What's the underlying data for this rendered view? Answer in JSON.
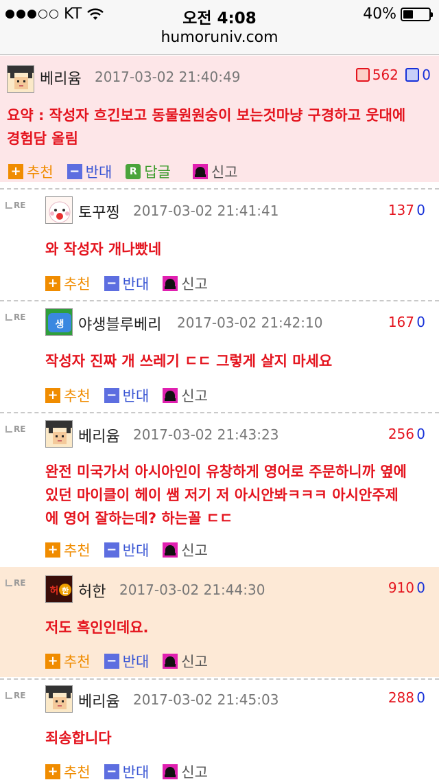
{
  "status": {
    "carrier": "KT",
    "time": "오전 4:08",
    "battery": "40%",
    "battery_level": 0.4
  },
  "url": "humoruniv.com",
  "post_comment": {
    "nick": "베리윰",
    "date": "2017-03-02 21:40:49",
    "likes": "562",
    "dislikes": "0",
    "body": [
      "요약 : 작성자 흐긴보고 동물원원숭이 보는것마냥 구경하고 웃대에",
      "경험담 올림"
    ],
    "actions": {
      "recommend": "추천",
      "oppose": "반대",
      "reply": "답글",
      "report": "신고"
    }
  },
  "replies": [
    {
      "re": "RE",
      "nick": "토꾸찡",
      "date": "2017-03-02 21:41:41",
      "likes": "137",
      "dislikes": "0",
      "body": [
        "와 작성자 개나빴네"
      ],
      "avatar": "face-avatar"
    },
    {
      "re": "RE",
      "nick": "야생블루베리",
      "date": "2017-03-02 21:42:10",
      "likes": "167",
      "dislikes": "0",
      "body": [
        "작성자 진짜 개 쓰레기 ㄷㄷ 그렇게 살지 마세요"
      ],
      "avatar": "saeng-avatar"
    },
    {
      "re": "RE",
      "nick": "베리윰",
      "date": "2017-03-02 21:43:23",
      "likes": "256",
      "dislikes": "0",
      "body": [
        "완전 미국가서 아시아인이 유창하게 영어로 주문하니까 옆에",
        "있던 마이클이 헤이 쌤 저기 저 아시안봐ㅋㅋㅋ 아시안주제",
        "에 영어 잘하는데? 하는꼴 ㄷㄷ"
      ],
      "avatar": "pixel-avatar"
    },
    {
      "re": "RE",
      "nick": "허한",
      "date": "2017-03-02 21:44:30",
      "likes": "910",
      "dislikes": "0",
      "body": [
        "저도 흑인인데요."
      ],
      "avatar": "heohan-avatar"
    },
    {
      "re": "RE",
      "nick": "베리윰",
      "date": "2017-03-02 21:45:03",
      "likes": "288",
      "dislikes": "0",
      "body": [
        "죄송합니다"
      ],
      "avatar": "pixel-avatar"
    }
  ],
  "actions": {
    "recommend": "추천",
    "oppose": "반대",
    "report": "신고"
  },
  "glyphs": {
    "plus": "+",
    "minus": "−",
    "reply_box": "R"
  }
}
